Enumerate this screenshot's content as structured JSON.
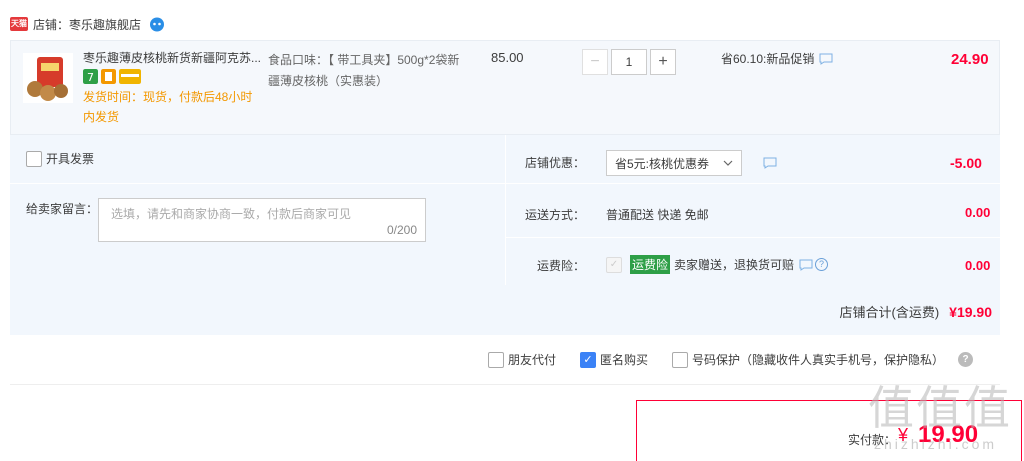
{
  "shop": {
    "badge_text": "天猫",
    "label": "店铺：枣乐趣旗舰店"
  },
  "item": {
    "title": "枣乐趣薄皮核桃新货新疆阿克苏...",
    "ship_note": "发货时间：现货，付款后48小时内发货",
    "sku": "食品口味：【 带工具夹】500g*2袋新疆薄皮核桃（实惠装）",
    "unit_price": "85.00",
    "quantity": "1",
    "qty_minus": "−",
    "qty_plus": "+",
    "promo": "省60.10:新品促销",
    "line_total": "24.90",
    "badge_colors": [
      "#2e9f47",
      "#f39800",
      "#f0b400"
    ]
  },
  "options": {
    "invoice_label": "开具发票",
    "message_label": "给卖家留言：",
    "message_placeholder": "选填，请先和商家协商一致，付款后商家可见",
    "message_count": "0/200",
    "coupon_label": "店铺优惠：",
    "coupon_selected": "省5元:核桃优惠券",
    "coupon_value": "-5.00",
    "shipping_label": "运送方式：",
    "shipping_value": "普通配送 快递 免邮",
    "shipping_cost": "0.00",
    "insurance_label": "运费险：",
    "insurance_tag": "运费险",
    "insurance_text": "卖家赠送，退换货可赔",
    "insurance_cost": "0.00"
  },
  "subtotal": {
    "label": "店铺合计(含运费)",
    "amount": "¥19.90"
  },
  "order_options": {
    "friend_pay": "朋友代付",
    "anonymous": "匿名购买",
    "number_protect": "号码保护（隐藏收件人真实手机号，保护隐私）",
    "help": "?"
  },
  "pay": {
    "label": "实付款：",
    "currency": "¥",
    "amount": "19.90"
  },
  "watermark": {
    "logo": "值值值",
    "site": "zhizhizhi.com"
  },
  "colors": {
    "accent_red": "#ff0036",
    "panel_bg": "#f2f7fd",
    "ship_orange": "#f39800",
    "insurance_green": "#2e9f47",
    "checkbox_blue": "#3b82f6"
  }
}
